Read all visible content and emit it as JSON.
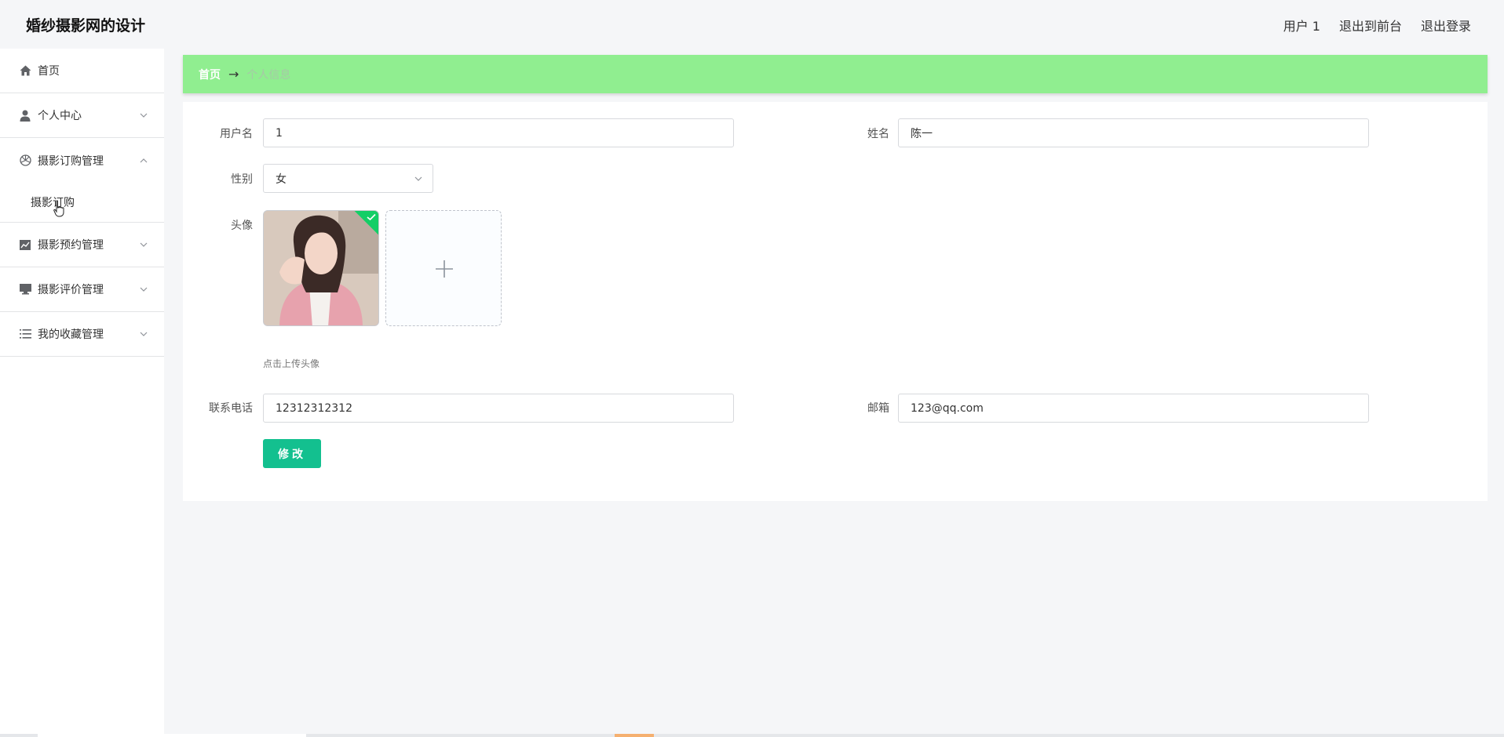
{
  "header": {
    "title": "婚纱摄影网的设计",
    "user": "用户 1",
    "to_front": "退出到前台",
    "logout": "退出登录"
  },
  "sidebar": {
    "items": [
      {
        "label": "首页",
        "icon": "home-icon"
      },
      {
        "label": "个人中心",
        "icon": "user-icon"
      },
      {
        "label": "摄影订购管理",
        "icon": "aperture-icon",
        "expanded": true,
        "children": [
          {
            "label": "摄影订购"
          }
        ]
      },
      {
        "label": "摄影预约管理",
        "icon": "chart-icon"
      },
      {
        "label": "摄影评价管理",
        "icon": "monitor-icon"
      },
      {
        "label": "我的收藏管理",
        "icon": "list-icon"
      }
    ]
  },
  "breadcrumb": {
    "home": "首页",
    "arrow": "→",
    "current": "个人信息"
  },
  "form": {
    "username_label": "用户名",
    "username_value": "1",
    "name_label": "姓名",
    "name_value": "陈一",
    "gender_label": "性别",
    "gender_value": "女",
    "avatar_label": "头像",
    "avatar_hint": "点击上传头像",
    "phone_label": "联系电话",
    "phone_value": "12312312312",
    "email_label": "邮箱",
    "email_value": "123@qq.com",
    "submit_label": "修改"
  },
  "colors": {
    "breadcrumb_bg": "#90ee90",
    "accent": "#13c08f",
    "upload_success": "#13ce66"
  }
}
